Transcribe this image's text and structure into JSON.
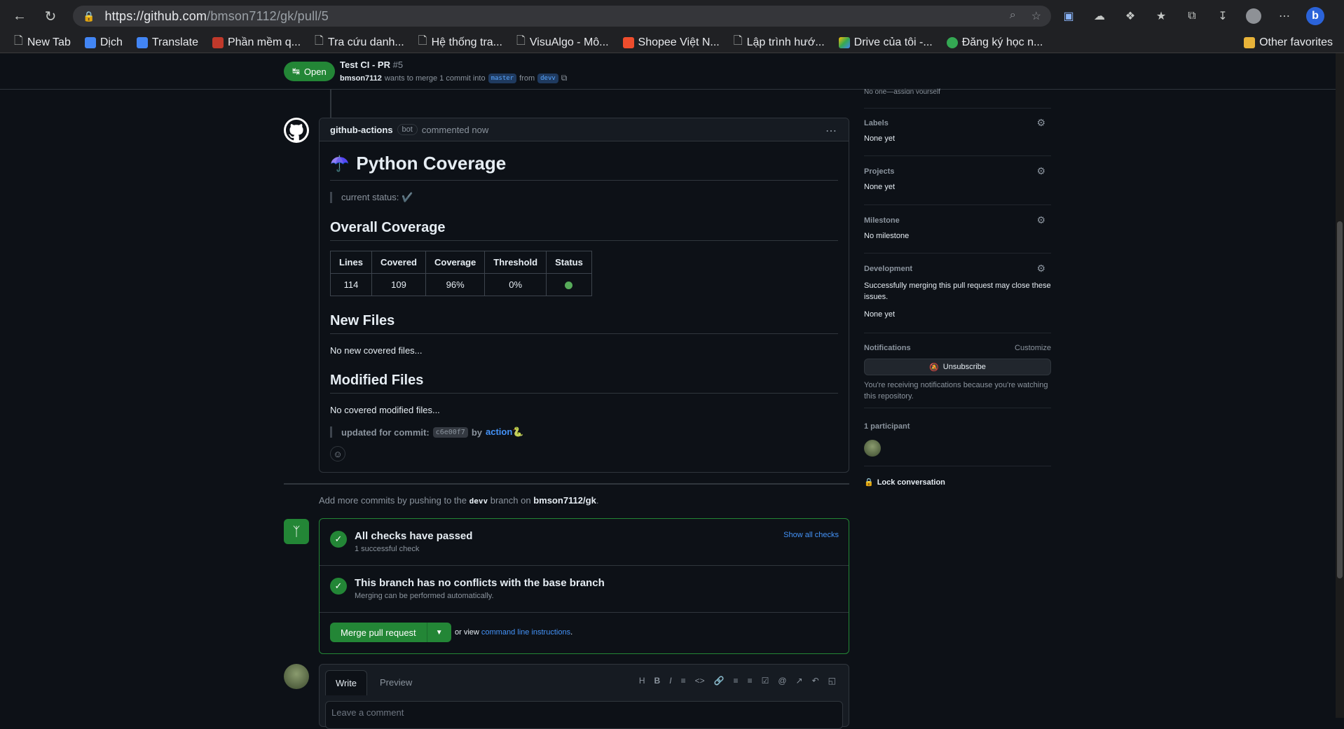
{
  "browser": {
    "url_host": "https://github.com",
    "url_path": "/bmson7112/gk/pull/5",
    "bookmarks": [
      "New Tab",
      "Dịch",
      "Translate",
      "Phần mềm q...",
      "Tra cứu danh...",
      "Hệ thống tra...",
      "VisuAlgo - Mô...",
      "Shopee Việt N...",
      "Lập trình hướ...",
      "Drive của tôi -...",
      "Đăng ký học n..."
    ],
    "other_favorites": "Other favorites"
  },
  "pr": {
    "state": "Open",
    "title": "Test CI - PR",
    "number": "#5",
    "author": "bmson7112",
    "meta_text": "wants to merge 1 commit into",
    "base_branch": "master",
    "from_text": "from",
    "head_branch": "devv"
  },
  "comment": {
    "author": "github-actions",
    "badge": "bot",
    "when": "commented now",
    "emoji": "☂️",
    "heading": "Python Coverage",
    "status_text": "current status: ✔️",
    "overall_heading": "Overall Coverage",
    "table": {
      "headers": [
        "Lines",
        "Covered",
        "Coverage",
        "Threshold",
        "Status"
      ],
      "row": [
        "114",
        "109",
        "96%",
        "0%",
        ""
      ]
    },
    "new_files_heading": "New Files",
    "new_files_text": "No new covered files...",
    "modified_heading": "Modified Files",
    "modified_text": "No covered modified files...",
    "updated_prefix": "updated for commit:",
    "commit_hash": "c6e00f7",
    "by_text": "by",
    "action_link": "action",
    "action_emoji": "🐍"
  },
  "add_commits": {
    "prefix": "Add more commits by pushing to the",
    "branch": "devv",
    "middle": "branch on",
    "repo": "bmson7112/gk",
    "suffix": "."
  },
  "merge": {
    "checks_title": "All checks have passed",
    "checks_sub": "1 successful check",
    "show_all": "Show all checks",
    "conflicts_title": "This branch has no conflicts with the base branch",
    "conflicts_sub": "Merging can be performed automatically.",
    "merge_button": "Merge pull request",
    "or_view": "or view",
    "cli_link": "command line instructions",
    "cli_suffix": "."
  },
  "composer": {
    "write_tab": "Write",
    "preview_tab": "Preview",
    "placeholder": "Leave a comment"
  },
  "sidebar": {
    "assignees_partial": "No one—assign yourself",
    "labels_label": "Labels",
    "labels_value": "None yet",
    "projects_label": "Projects",
    "projects_value": "None yet",
    "milestone_label": "Milestone",
    "milestone_value": "No milestone",
    "development_label": "Development",
    "development_text": "Successfully merging this pull request may close these issues.",
    "development_value": "None yet",
    "notifications_label": "Notifications",
    "customize": "Customize",
    "unsubscribe": "Unsubscribe",
    "notif_text": "You're receiving notifications because you're watching this repository.",
    "participants": "1 participant",
    "lock": "Lock conversation"
  },
  "colors": {
    "accent_green": "#238636",
    "link_blue": "#4493f8",
    "bg": "#0d1117"
  }
}
